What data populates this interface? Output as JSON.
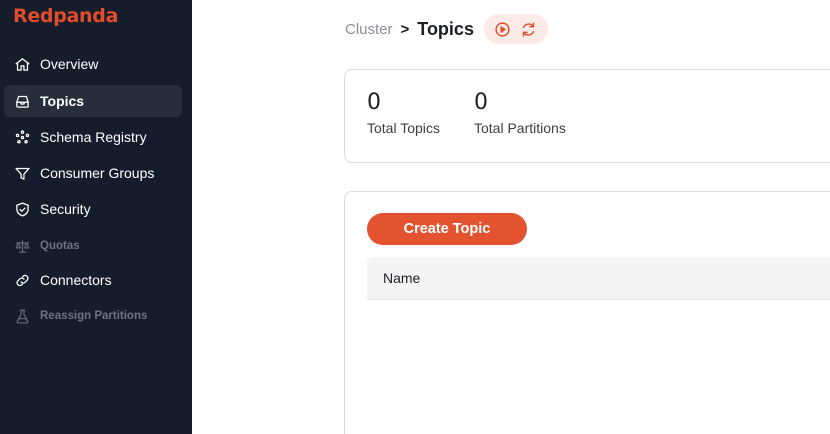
{
  "sidebar": {
    "logo": "Redpanda",
    "items": [
      {
        "label": "Overview",
        "icon": "home-icon",
        "active": false,
        "disabled": false
      },
      {
        "label": "Topics",
        "icon": "inbox-icon",
        "active": true,
        "disabled": false
      },
      {
        "label": "Schema Registry",
        "icon": "schema-icon",
        "active": false,
        "disabled": false
      },
      {
        "label": "Consumer Groups",
        "icon": "funnel-icon",
        "active": false,
        "disabled": false
      },
      {
        "label": "Security",
        "icon": "shield-icon",
        "active": false,
        "disabled": false
      },
      {
        "label": "Quotas",
        "icon": "scale-icon",
        "active": false,
        "disabled": true
      },
      {
        "label": "Connectors",
        "icon": "link-icon",
        "active": false,
        "disabled": false
      },
      {
        "label": "Reassign Partitions",
        "icon": "beaker-icon",
        "active": false,
        "disabled": true
      }
    ]
  },
  "breadcrumb": {
    "parent": "Cluster",
    "separator": ">",
    "current": "Topics",
    "actions": [
      "play-circle-icon",
      "refresh-icon"
    ]
  },
  "stats": [
    {
      "value": "0",
      "label": "Total Topics"
    },
    {
      "value": "0",
      "label": "Total Partitions"
    }
  ],
  "topics": {
    "create_label": "Create Topic",
    "columns": [
      "Name"
    ]
  },
  "colors": {
    "sidebar_bg": "#151c2b",
    "brand": "#e14d2a",
    "active_item_bg": "#262e3c"
  }
}
